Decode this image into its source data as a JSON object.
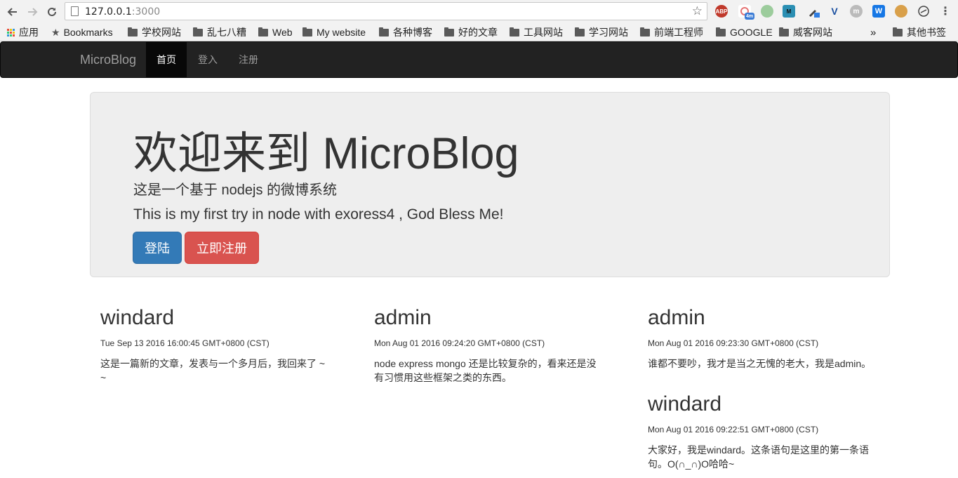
{
  "browser": {
    "url_host": "127.0.0.1",
    "url_port": ":3000",
    "extensions": [
      "ABP",
      "4m",
      "",
      "M",
      "",
      "V",
      "m",
      "W",
      "",
      ""
    ],
    "bookmarks": [
      {
        "label": "应用",
        "kind": "apps"
      },
      {
        "label": "Bookmarks",
        "kind": "star"
      },
      {
        "label": "学校网站",
        "kind": "folder"
      },
      {
        "label": "乱七八糟",
        "kind": "folder"
      },
      {
        "label": "Web",
        "kind": "folder"
      },
      {
        "label": "My website",
        "kind": "folder"
      },
      {
        "label": "各种博客",
        "kind": "folder"
      },
      {
        "label": "好的文章",
        "kind": "folder"
      },
      {
        "label": "工具网站",
        "kind": "folder"
      },
      {
        "label": "学习网站",
        "kind": "folder"
      },
      {
        "label": "前端工程师",
        "kind": "folder"
      },
      {
        "label": "GOOGLE",
        "kind": "folder"
      },
      {
        "label": "威客网站",
        "kind": "folder"
      }
    ],
    "overflow_label": "»",
    "other_bookmarks": "其他书签"
  },
  "navbar": {
    "brand": "MicroBlog",
    "items": [
      "首页",
      "登入",
      "注册"
    ]
  },
  "jumbotron": {
    "title": "欢迎来到 MicroBlog",
    "subtitle": "这是一个基于 nodejs 的微博系统",
    "tagline": "This is my first try in node with exoress4 , God Bless Me!",
    "login_button": "登陆",
    "register_button": "立即注册"
  },
  "posts": [
    {
      "author": "windard",
      "time": "Tue Sep 13 2016 16:00:45 GMT+0800 (CST)",
      "content": "这是一篇新的文章，发表与一个多月后，我回来了 ~ ~"
    },
    {
      "author": "admin",
      "time": "Mon Aug 01 2016 09:24:20 GMT+0800 (CST)",
      "content": "node express mongo 还是比较复杂的，看来还是没有习惯用这些框架之类的东西。"
    },
    {
      "author": "admin",
      "time": "Mon Aug 01 2016 09:23:30 GMT+0800 (CST)",
      "content": "谁都不要吵，我才是当之无愧的老大，我是admin。"
    },
    {
      "author": "windard",
      "time": "Mon Aug 01 2016 09:22:51 GMT+0800 (CST)",
      "content": "大家好，我是windard。这条语句是这里的第一条语句。O(∩_∩)O哈哈~"
    }
  ],
  "colors": {
    "primary": "#337ab7",
    "danger": "#d9534f",
    "navbar_bg": "#222222"
  }
}
